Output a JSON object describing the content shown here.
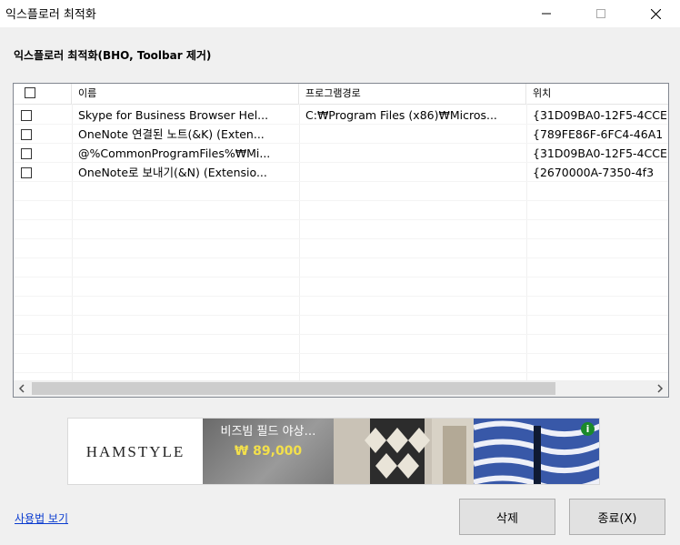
{
  "window": {
    "title": "익스플로러 최적화",
    "minimize_icon": "minimize-icon",
    "maximize_icon": "maximize-icon",
    "close_icon": "close-icon"
  },
  "heading": "익스플로러 최적화(BHO, Toolbar 제거)",
  "table": {
    "columns": [
      "",
      "이름",
      "프로그램경로",
      "위치"
    ],
    "rows": [
      {
        "checked": false,
        "name": "Skype for Business Browser Hel...",
        "path": "C:₩Program Files (x86)₩Micros...",
        "location": "{31D09BA0-12F5-4CCE"
      },
      {
        "checked": false,
        "name": "OneNote 연결된 노트(&K) (Exten...",
        "path": "",
        "location": "{789FE86F-6FC4-46A1"
      },
      {
        "checked": false,
        "name": "@%CommonProgramFiles%₩Mi...",
        "path": "",
        "location": "{31D09BA0-12F5-4CCE"
      },
      {
        "checked": false,
        "name": "OneNote로 보내기(&N) (Extensio...",
        "path": "",
        "location": "{2670000A-7350-4f3"
      }
    ]
  },
  "scrollbar": {
    "left_icon": "chevron-left-icon",
    "right_icon": "chevron-right-icon"
  },
  "ad": {
    "brand": "HAMSTYLE",
    "caption": "비즈빔 필드 야상…",
    "price": "₩ 89,000",
    "info_label": "i"
  },
  "footer": {
    "help_link": "사용법 보기",
    "delete_button": "삭제",
    "exit_button": "종료(X)"
  }
}
